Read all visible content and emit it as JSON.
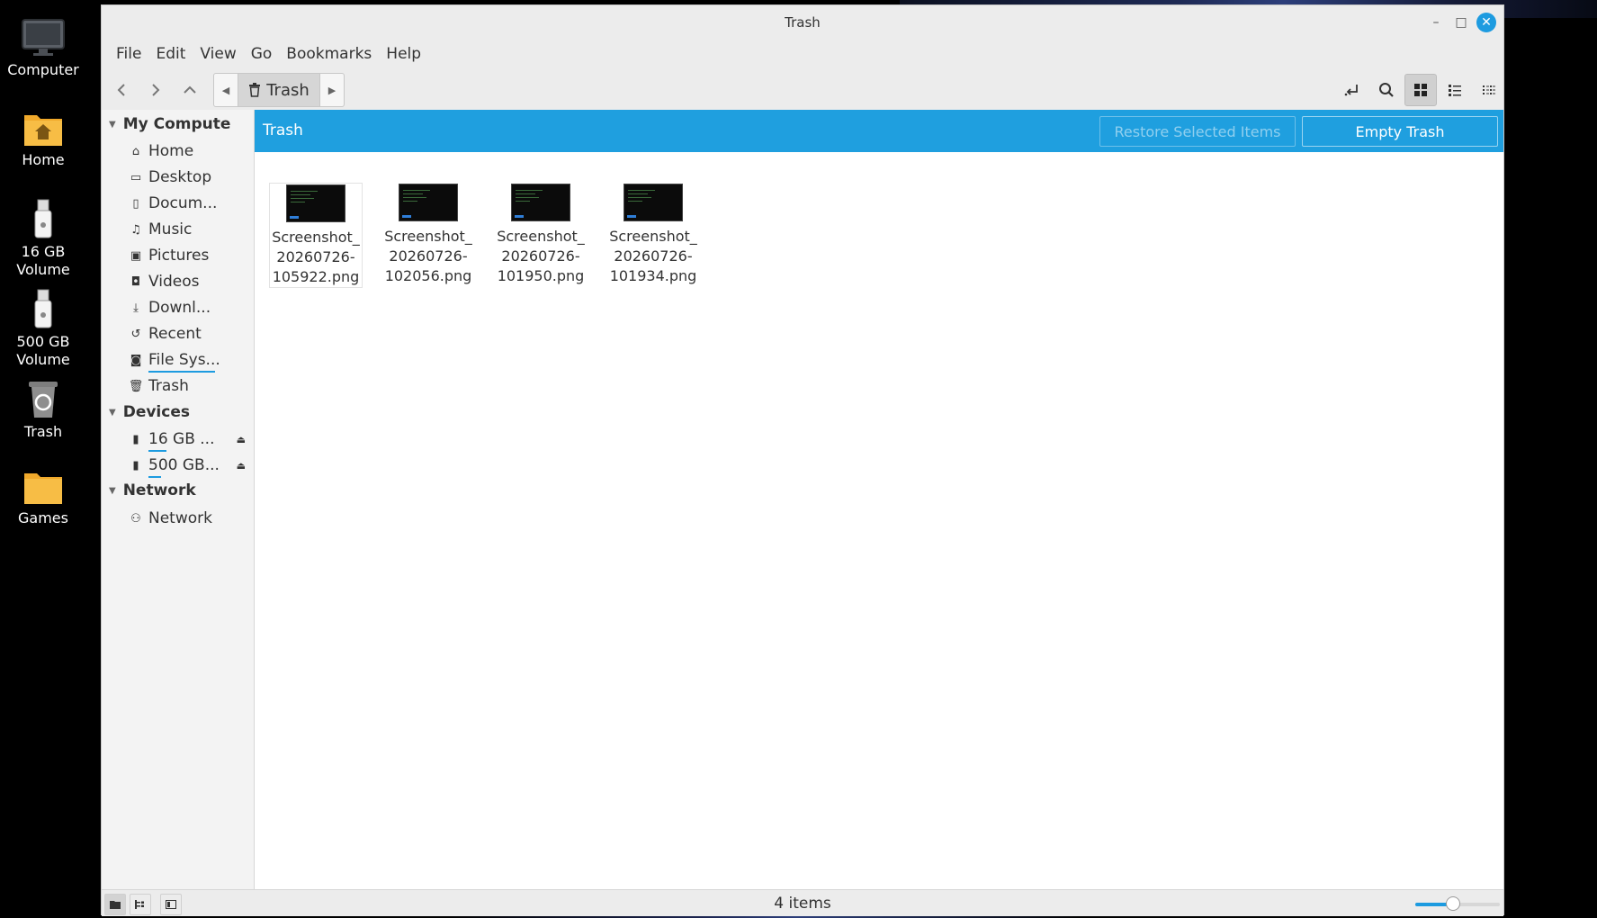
{
  "window": {
    "title": "Trash"
  },
  "menu": [
    "File",
    "Edit",
    "View",
    "Go",
    "Bookmarks",
    "Help"
  ],
  "pathbar": {
    "crumb": "Trash"
  },
  "desktop": [
    {
      "label": "Computer",
      "icon": "computer-icon"
    },
    {
      "label": "Home",
      "icon": "home-folder-icon"
    },
    {
      "label": "16 GB Volume",
      "icon": "usb-drive-icon"
    },
    {
      "label": "500 GB Volume",
      "icon": "usb-drive-icon"
    },
    {
      "label": "Trash",
      "icon": "trash-icon"
    },
    {
      "label": "Games",
      "icon": "folder-icon"
    }
  ],
  "sidebar": {
    "sections": [
      {
        "heading": "My Compute",
        "items": [
          {
            "label": "Home",
            "icon": "home-icon"
          },
          {
            "label": "Desktop",
            "icon": "folder-icon"
          },
          {
            "label": "Docum...",
            "icon": "document-icon"
          },
          {
            "label": "Music",
            "icon": "music-icon"
          },
          {
            "label": "Pictures",
            "icon": "picture-icon"
          },
          {
            "label": "Videos",
            "icon": "video-icon"
          },
          {
            "label": "Downl...",
            "icon": "download-icon"
          },
          {
            "label": "Recent",
            "icon": "recent-icon"
          },
          {
            "label": "File Sys...",
            "icon": "drive-icon"
          },
          {
            "label": "Trash",
            "icon": "trash-icon"
          }
        ]
      },
      {
        "heading": "Devices",
        "items": [
          {
            "label": "16 GB ...",
            "icon": "usb-drive-icon"
          },
          {
            "label": "500 GB...",
            "icon": "usb-drive-icon"
          }
        ]
      },
      {
        "heading": "Network",
        "items": [
          {
            "label": "Network",
            "icon": "network-icon"
          }
        ]
      }
    ]
  },
  "infobar": {
    "title": "Trash",
    "restore_label": "Restore Selected Items",
    "empty_label": "Empty Trash"
  },
  "files": [
    {
      "line1": "Screenshot_",
      "line2": "20260726-",
      "line3": "105922.png"
    },
    {
      "line1": "Screenshot_",
      "line2": "20260726-",
      "line3": "102056.png"
    },
    {
      "line1": "Screenshot_",
      "line2": "20260726-",
      "line3": "101950.png"
    },
    {
      "line1": "Screenshot_",
      "line2": "20260726-",
      "line3": "101934.png"
    }
  ],
  "status": {
    "text": "4 items",
    "zoom_level": 0.45
  },
  "colors": {
    "accent": "#1f9fdf",
    "window_bg": "#ececec",
    "content_bg": "#ffffff"
  }
}
